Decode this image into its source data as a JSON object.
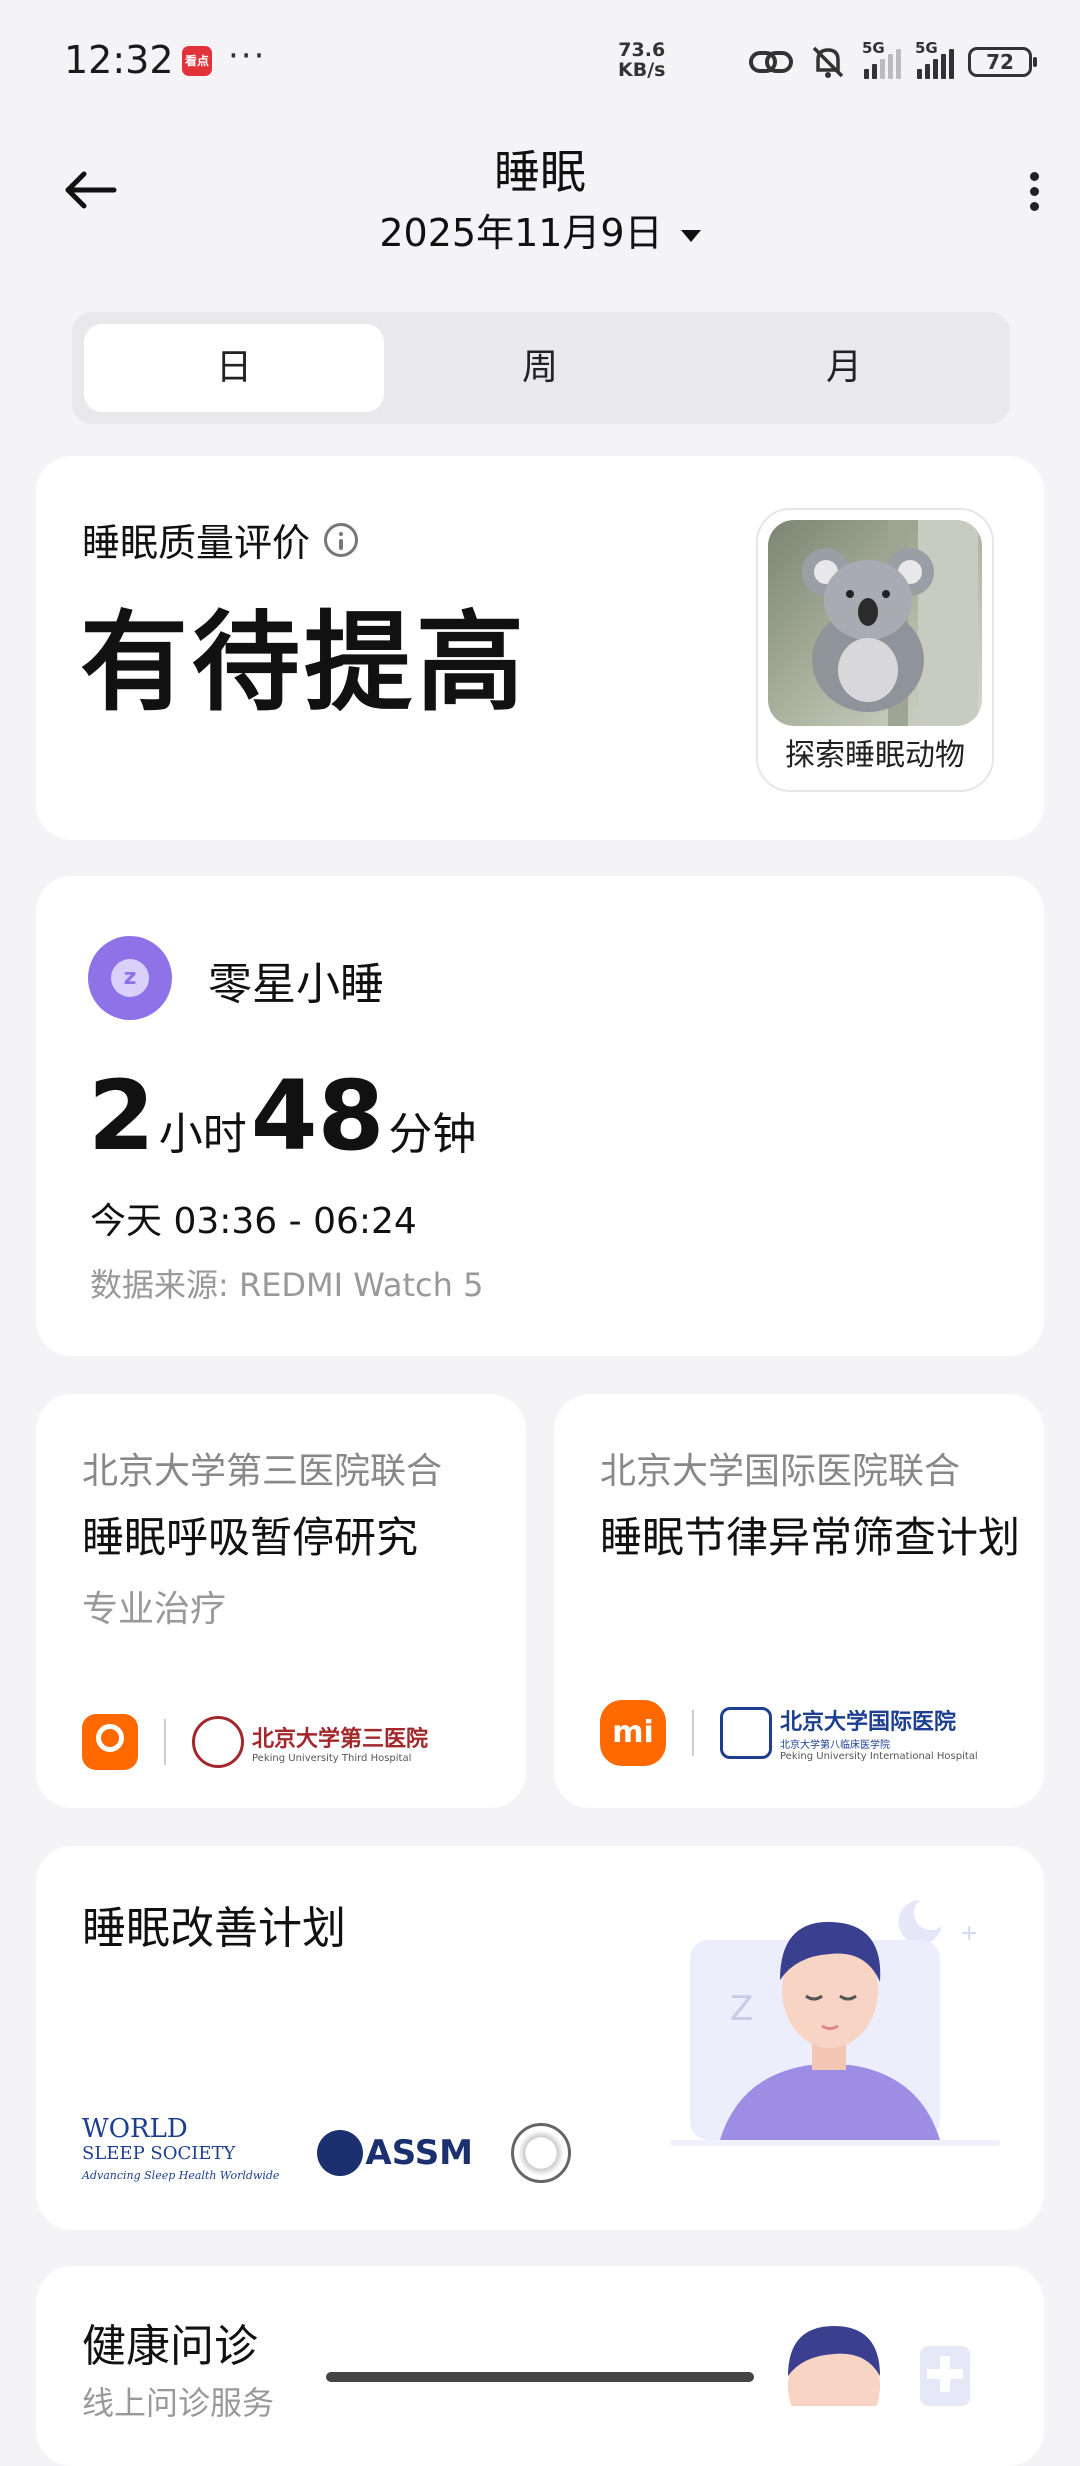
{
  "status_bar": {
    "time": "12:32",
    "app_badge": "看点",
    "more": "···",
    "net_speed_value": "73.6",
    "net_speed_unit": "KB/s",
    "signal_1_label": "5G",
    "signal_2_label": "5G",
    "battery": "72"
  },
  "header": {
    "title": "睡眠",
    "date": "2025年11月9日"
  },
  "tabs": [
    {
      "label": "日",
      "active": true
    },
    {
      "label": "周",
      "active": false
    },
    {
      "label": "月",
      "active": false
    }
  ],
  "quality_card": {
    "label": "睡眠质量评价",
    "value": "有待提高",
    "animal_label": "探索睡眠动物"
  },
  "nap_card": {
    "title": "零星小睡",
    "hours": "2",
    "hours_unit": "小时",
    "minutes": "48",
    "minutes_unit": "分钟",
    "time_range": "今天 03:36 - 06:24",
    "source": "数据来源: REDMI Watch 5"
  },
  "studies": [
    {
      "org": "北京大学第三医院联合",
      "title": "睡眠呼吸暂停研究",
      "tag": "专业治疗",
      "partner_cn": "北京大学第三医院",
      "partner_en": "Peking University Third Hospital"
    },
    {
      "org": "北京大学国际医院联合",
      "title": "睡眠节律异常筛查计划",
      "partner_cn": "北京大学国际医院",
      "partner_cn_2": "北京大学第八临床医学院",
      "partner_en": "Peking University International Hospital"
    }
  ],
  "plan_card": {
    "title": "睡眠改善计划",
    "wss_line1": "WORLD",
    "wss_line2": "SLEEP SOCIETY",
    "wss_tagline": "Advancing Sleep Health Worldwide",
    "assm": "ASSM"
  },
  "consult_card": {
    "title": "健康问诊",
    "subtitle": "线上问诊服务"
  },
  "colors": {
    "accent_purple": "#8f72e8",
    "brand_orange": "#ff6900",
    "background": "#f4f4f6"
  }
}
